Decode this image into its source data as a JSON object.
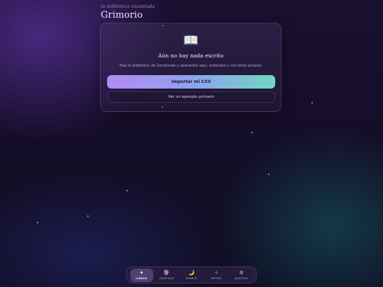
{
  "header": {
    "eyebrow": "tu biblioteca encantada",
    "title": "Grimorio"
  },
  "empty_state": {
    "icon": "open-book-icon",
    "title": "Aún no hay nada escrito",
    "description": "Trae tu biblioteca de Goodreads y aparecerá aquí, ordenada y con listas propias.",
    "primary_button": "Importar mi CSV",
    "secondary_button": "Ver un ejemplo primero"
  },
  "nav": {
    "tabs": [
      {
        "label": "LIBROS",
        "icon": "sparkle-icon",
        "glyph": "✦",
        "active": true
      },
      {
        "label": "ORÁCULO",
        "icon": "crystal-ball-icon",
        "glyph": "🔮",
        "active": false
      },
      {
        "label": "DIARIO",
        "icon": "moon-icon",
        "glyph": "🌙",
        "active": false
      },
      {
        "label": "METAS",
        "icon": "star-icon",
        "glyph": "✧",
        "active": false
      },
      {
        "label": "AJUSTES",
        "icon": "gear-icon",
        "glyph": "⚙",
        "active": false
      }
    ]
  },
  "colors": {
    "accent_start": "#b18cf2",
    "accent_end": "#6fd8c0",
    "background": "#140d27"
  }
}
